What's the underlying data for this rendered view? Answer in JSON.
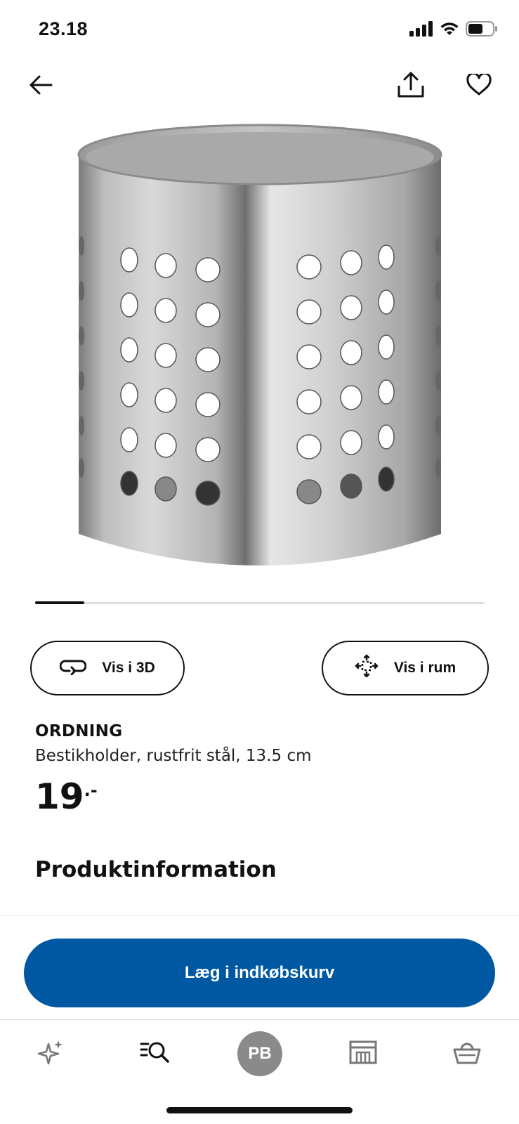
{
  "status_bar": {
    "time": "23.18",
    "icons": [
      "cellular-signal-icon",
      "wifi-icon",
      "battery-icon"
    ]
  },
  "top_nav": {
    "icons": [
      "back-arrow-icon",
      "share-icon",
      "heart-icon"
    ]
  },
  "carousel": {
    "current_index": 1
  },
  "buttons": {
    "view_3d_label": "Vis i 3D",
    "view_in_room_label": "Vis i rum",
    "add_to_cart_label": "Læg i indkøbskurv"
  },
  "product": {
    "name": "ORDNING",
    "description": "Bestikholder, rustfrit stål, 13.5 cm",
    "price_main": "19",
    "price_suffix": ".-"
  },
  "sections": {
    "product_info_title": "Produktinformation"
  },
  "tab_bar": {
    "profile_initials": "PB",
    "icons": [
      "sparkle-icon",
      "search-list-icon",
      "avatar",
      "store-icon",
      "basket-icon"
    ]
  },
  "colors": {
    "primary_button": "#0058a3",
    "text": "#111111",
    "avatar_bg": "#8a8a8a"
  }
}
